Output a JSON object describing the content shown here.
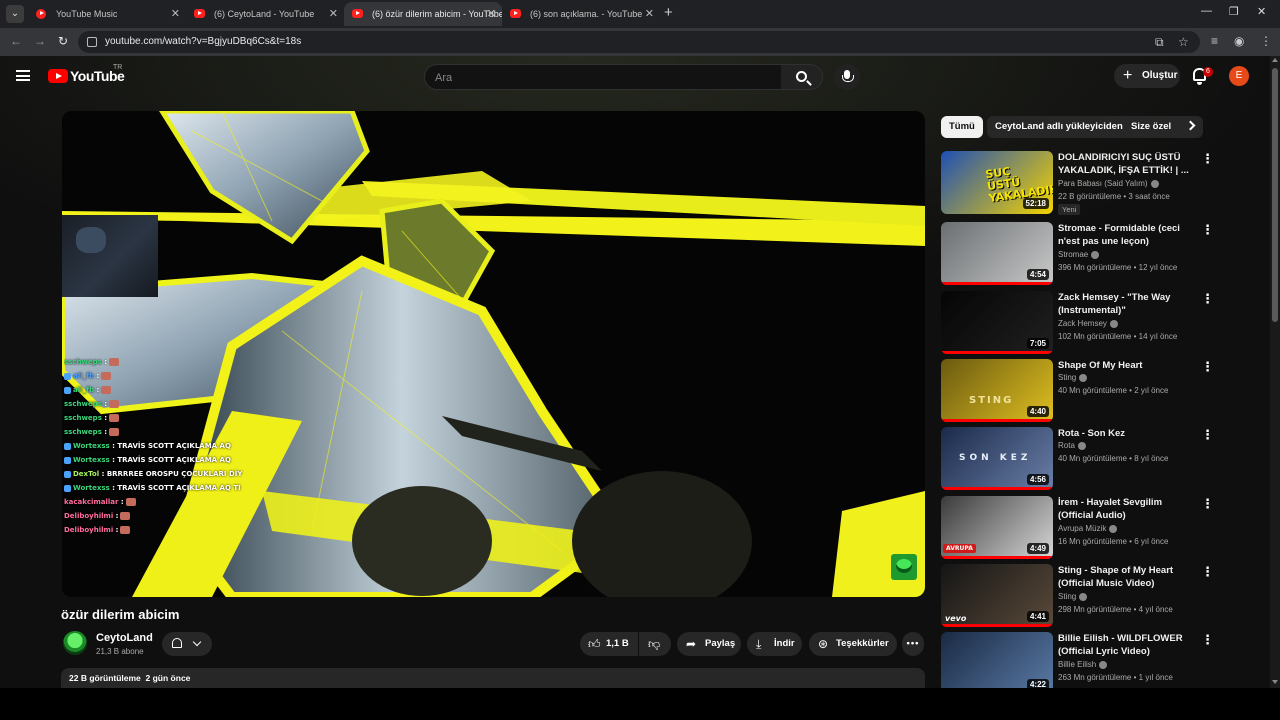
{
  "browser": {
    "tabs": [
      {
        "title": "YouTube Music",
        "active": false
      },
      {
        "title": "(6) CeytoLand - YouTube",
        "active": false
      },
      {
        "title": "(6) özür dilerim abicim - YouTube",
        "active": true
      },
      {
        "title": "(6) son açıklama. - YouTube",
        "active": false
      }
    ],
    "url": "youtube.com/watch?v=BgjyuDBq6Cs&t=18s"
  },
  "masthead": {
    "logo_text": "YouTube",
    "country_code": "TR",
    "search_placeholder": "Ara",
    "create_label": "Oluştur",
    "notification_count": "6",
    "avatar_letter": "E"
  },
  "player": {
    "chat": [
      {
        "name": "sschweps",
        "message": ":",
        "emote": true,
        "icons": false
      },
      {
        "name": "ali_fb",
        "message": ":",
        "emote": true,
        "icons": true
      },
      {
        "name": "ali_fb",
        "message": ":",
        "emote": true,
        "icons": true
      },
      {
        "name": "sschweps",
        "message": ":",
        "emote": true,
        "icons": false
      },
      {
        "name": "sschweps",
        "message": ":",
        "emote": true,
        "icons": false
      },
      {
        "name": "sschweps",
        "message": ":",
        "emote": true,
        "icons": false
      },
      {
        "name": "Wortexss",
        "message": ": TRAVİS SCOTT AÇIKLAMA AQ",
        "emote": false,
        "icons": true
      },
      {
        "name": "Wortexss",
        "message": ": TRAVİS SCOTT AÇIKLAMA AQ",
        "emote": false,
        "icons": true
      },
      {
        "name": "DexTol",
        "message": ": BRRRREE OROSPU ÇOCUKLARI DİY",
        "emote": false,
        "icons": true
      },
      {
        "name": "Wortexss",
        "message": ": TRAVİS SCOTT AÇIKLAMA AQ TI",
        "emote": false,
        "icons": true
      },
      {
        "name": "kacakcimallar",
        "message": ":",
        "emote": true,
        "icons": false
      },
      {
        "name": "Deliboyhilmi",
        "message": ":",
        "emote": true,
        "icons": false
      },
      {
        "name": "Deliboyhilmi",
        "message": ":",
        "emote": true,
        "icons": false
      }
    ]
  },
  "video": {
    "title": "özür dilerim abicim",
    "channel_name": "CeytoLand",
    "subscribers": "21,3 B abone",
    "likes": "1,1 B",
    "share_label": "Paylaş",
    "download_label": "İndir",
    "thanks_label": "Teşekkürler",
    "views": "22 B görüntüleme",
    "uploaded": "2 gün önce"
  },
  "chips": [
    "Tümü",
    "CeytoLand adlı yükleyiciden",
    "Size özel"
  ],
  "recommendations": [
    {
      "title": "DOLANDIRICIYI SUÇ ÜSTÜ YAKALADIK, İFŞA ETTİK! | ...",
      "channel": "Para Babası (Said Yalım)",
      "verified": true,
      "views": "22 B görüntüleme",
      "age": "3 saat önce",
      "duration": "52:18",
      "badge": "Yeni",
      "progress": 0,
      "thumb_text": "SUÇ ÜSTÜ YAKALADIK",
      "thumb_colors": [
        "#1f4fb5",
        "#f5d400"
      ]
    },
    {
      "title": "Stromae - Formidable (ceci n'est pas une leçon)",
      "channel": "Stromae",
      "verified": true,
      "views": "396 Mn görüntüleme",
      "age": "12 yıl önce",
      "duration": "4:54",
      "badge": "",
      "progress": 1,
      "thumb_text": "",
      "thumb_colors": [
        "#6a6f72",
        "#c9c9c9"
      ]
    },
    {
      "title": "Zack Hemsey - \"The Way (Instrumental)\"",
      "channel": "Zack Hemsey",
      "verified": true,
      "views": "102 Mn görüntüleme",
      "age": "14 yıl önce",
      "duration": "7:05",
      "badge": "",
      "progress": 1,
      "thumb_text": "",
      "thumb_colors": [
        "#050505",
        "#202020"
      ]
    },
    {
      "title": "Shape Of My Heart",
      "channel": "Sting",
      "verified": true,
      "views": "40 Mn görüntüleme",
      "age": "2 yıl önce",
      "duration": "4:40",
      "badge": "",
      "progress": 1,
      "thumb_text": "STING",
      "thumb_colors": [
        "#6b5a10",
        "#e0c020"
      ]
    },
    {
      "title": "Rota - Son Kez",
      "channel": "Rota",
      "verified": true,
      "views": "40 Mn görüntüleme",
      "age": "8 yıl önce",
      "duration": "4:56",
      "badge": "",
      "progress": 1,
      "thumb_text": "SON KEZ",
      "thumb_colors": [
        "#1b2a4a",
        "#6a7fa8"
      ]
    },
    {
      "title": "İrem - Hayalet Sevgilim (Official Audio)",
      "channel": "Avrupa Müzik",
      "verified": true,
      "views": "16 Mn görüntüleme",
      "age": "6 yıl önce",
      "duration": "4:49",
      "badge": "",
      "progress": 1,
      "thumb_text": "AVRUPA",
      "thumb_colors": [
        "#3a3a3a",
        "#d8d8d8"
      ]
    },
    {
      "title": "Sting - Shape of My Heart (Official Music Video)",
      "channel": "Sting",
      "verified": true,
      "views": "298 Mn görüntüleme",
      "age": "4 yıl önce",
      "duration": "4:41",
      "badge": "",
      "progress": 1,
      "thumb_text": "vevo",
      "thumb_colors": [
        "#151515",
        "#5a4a3a"
      ]
    },
    {
      "title": "Billie Eilish - WILDFLOWER (Official Lyric Video)",
      "channel": "Billie Eilish",
      "verified": true,
      "views": "263 Mn görüntüleme",
      "age": "1 yıl önce",
      "duration": "4:22",
      "badge": "",
      "progress": 0,
      "thumb_text": "",
      "thumb_colors": [
        "#1a2a44",
        "#5a7aa6"
      ]
    }
  ]
}
